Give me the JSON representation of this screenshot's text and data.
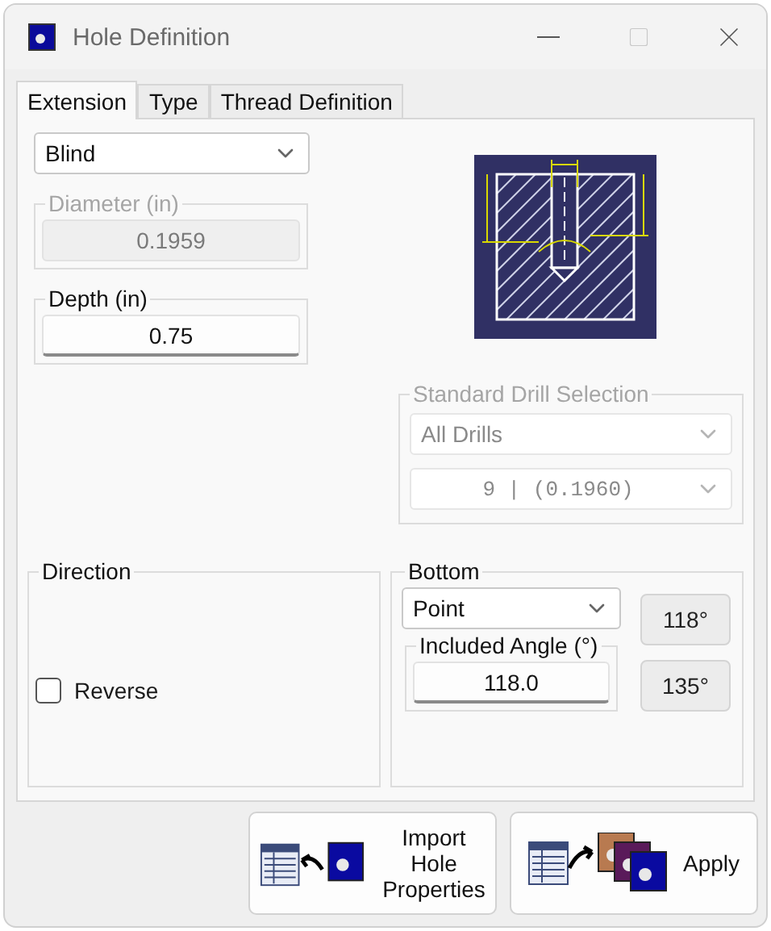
{
  "window": {
    "title": "Hole Definition"
  },
  "tabs": [
    {
      "label": "Extension",
      "selected": true
    },
    {
      "label": "Type",
      "selected": false
    },
    {
      "label": "Thread Definition",
      "selected": false
    }
  ],
  "extension": {
    "value": "Blind"
  },
  "diameter": {
    "label": "Diameter (in)",
    "value": "0.1959",
    "disabled": true
  },
  "depth": {
    "label": "Depth (in)",
    "value": "0.75",
    "disabled": false
  },
  "standard_drill_selection": {
    "title": "Standard Drill Selection",
    "disabled": true,
    "category": "All Drills",
    "size": "9 | (0.1960)"
  },
  "direction": {
    "title": "Direction",
    "reverse": {
      "label": "Reverse",
      "checked": false
    }
  },
  "bottom": {
    "title": "Bottom",
    "type": "Point",
    "included_angle": {
      "label": "Included Angle (°)",
      "value": "118.0"
    },
    "presets": [
      "118°",
      "135°"
    ]
  },
  "buttons": [
    {
      "label": "Import Hole Properties",
      "kind": "import"
    },
    {
      "label": "Apply",
      "kind": "apply"
    }
  ]
}
